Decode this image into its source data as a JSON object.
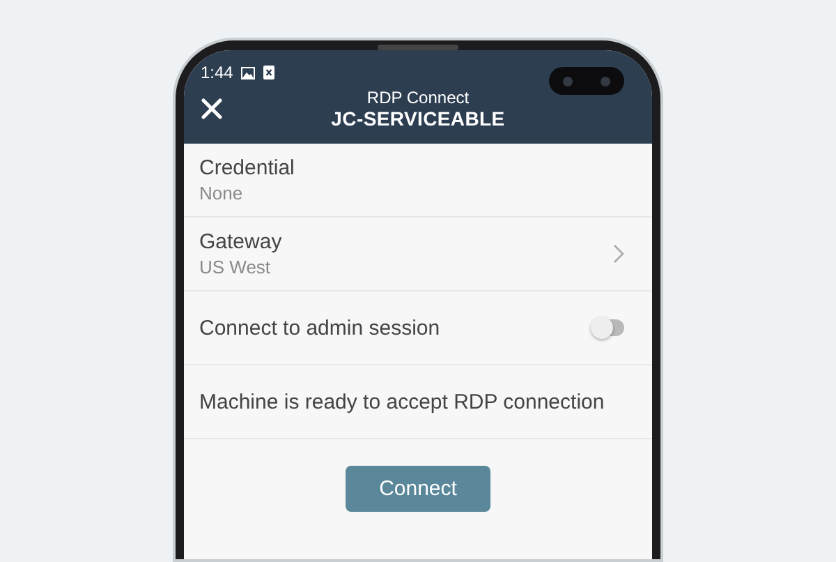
{
  "status_bar": {
    "time": "1:44"
  },
  "header": {
    "subtitle": "RDP Connect",
    "title": "JC-SERVICEABLE"
  },
  "items": [
    {
      "kind": "detail",
      "label": "Credential",
      "value": "None"
    },
    {
      "kind": "link",
      "label": "Gateway",
      "value": "US West"
    },
    {
      "kind": "toggle",
      "label": "Connect to admin session",
      "on": false
    },
    {
      "kind": "message",
      "label": "Machine is ready to accept RDP connection"
    }
  ],
  "button": {
    "label": "Connect"
  }
}
